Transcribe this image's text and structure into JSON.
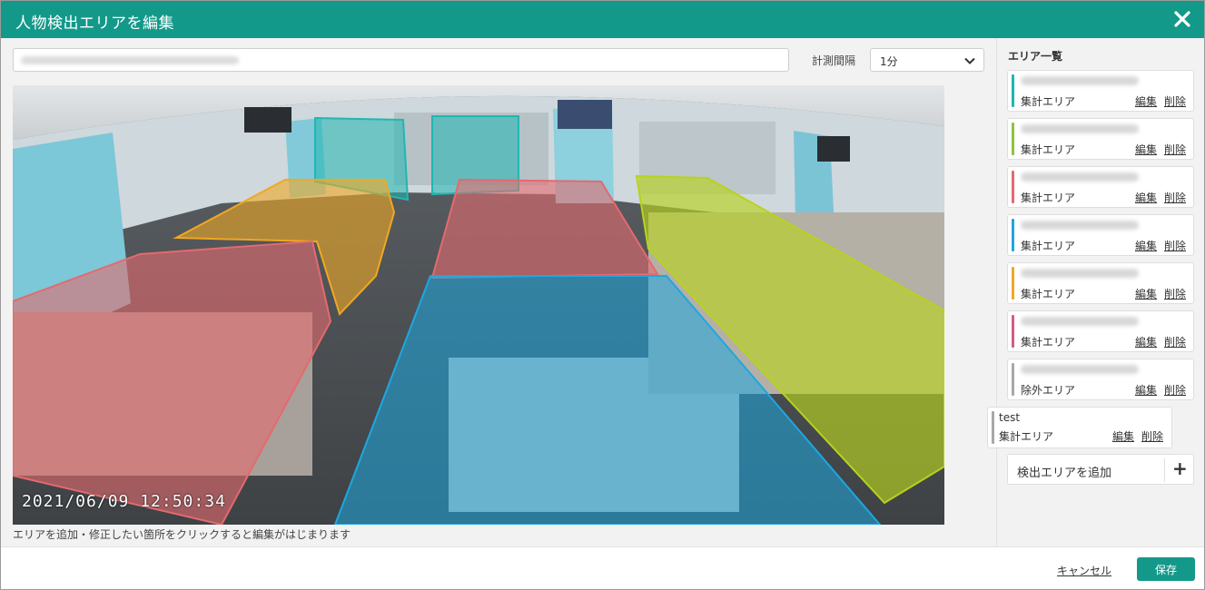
{
  "window": {
    "title": "人物検出エリアを編集"
  },
  "colors": {
    "header": "#13998a",
    "accent": "#13998a"
  },
  "toolbar": {
    "area_name_value": "",
    "interval_label": "計測間隔",
    "interval_value": "1分"
  },
  "camera": {
    "timestamp": "2021/06/09 12:50:34"
  },
  "help_text": "エリアを追加・修正したい箇所をクリックすると編集がはじまります",
  "area_list": {
    "title": "エリア一覧",
    "items": [
      {
        "type": "集計エリア",
        "color": "#20b7b0",
        "edit": "編集",
        "delete": "削除"
      },
      {
        "type": "集計エリア",
        "color": "#8fc43a",
        "edit": "編集",
        "delete": "削除"
      },
      {
        "type": "集計エリア",
        "color": "#e46a6e",
        "edit": "編集",
        "delete": "削除"
      },
      {
        "type": "集計エリア",
        "color": "#1ea7e0",
        "edit": "編集",
        "delete": "削除"
      },
      {
        "type": "集計エリア",
        "color": "#f0a823",
        "edit": "編集",
        "delete": "削除"
      },
      {
        "type": "集計エリア",
        "color": "#d65a84",
        "edit": "編集",
        "delete": "削除"
      },
      {
        "type": "除外エリア",
        "color": "#a8a8a8",
        "edit": "編集",
        "delete": "削除"
      }
    ],
    "test_item": {
      "name": "test",
      "type": "集計エリア",
      "color": "#a8a8a8",
      "edit": "編集",
      "delete": "削除"
    },
    "add_label": "検出エリアを追加",
    "add_icon": "+"
  },
  "footer": {
    "cancel_label": "キャンセル",
    "save_label": "保存"
  }
}
